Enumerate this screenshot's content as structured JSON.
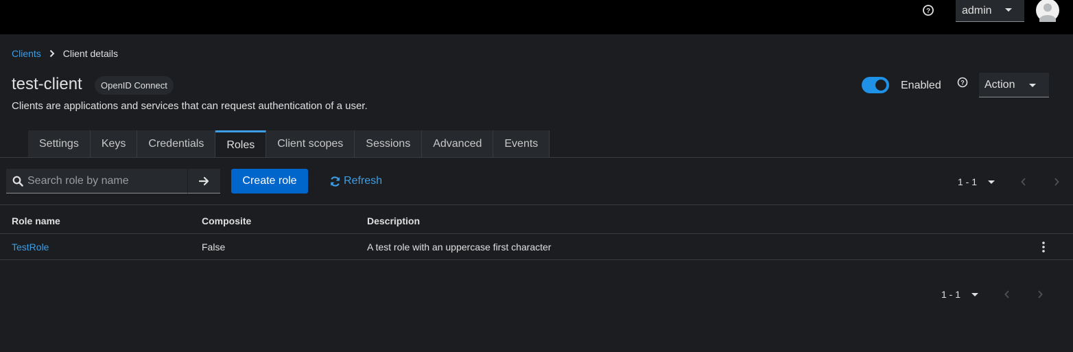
{
  "header": {
    "user": "admin"
  },
  "breadcrumb": {
    "parent": "Clients",
    "current": "Client details"
  },
  "client": {
    "name": "test-client",
    "protocol": "OpenID Connect",
    "description": "Clients are applications and services that can request authentication of a user.",
    "enabled_label": "Enabled",
    "enabled": true,
    "action_label": "Action"
  },
  "tabs": [
    {
      "label": "Settings",
      "active": false
    },
    {
      "label": "Keys",
      "active": false
    },
    {
      "label": "Credentials",
      "active": false
    },
    {
      "label": "Roles",
      "active": true
    },
    {
      "label": "Client scopes",
      "active": false
    },
    {
      "label": "Sessions",
      "active": false
    },
    {
      "label": "Advanced",
      "active": false
    },
    {
      "label": "Events",
      "active": false
    }
  ],
  "toolbar": {
    "search_placeholder": "Search role by name",
    "create_label": "Create role",
    "refresh_label": "Refresh",
    "pagination_top": "1 - 1",
    "pagination_bottom": "1 - 1"
  },
  "table": {
    "columns": [
      "Role name",
      "Composite",
      "Description"
    ],
    "rows": [
      [
        "TestRole",
        "False",
        "A test role with an uppercase first character"
      ]
    ]
  },
  "colors": {
    "accent": "#0066cc",
    "link": "#3d9ee6",
    "toggle_on": "#1f91e6",
    "background": "#1b1d21"
  },
  "icons": [
    "help-icon",
    "caret-down-icon",
    "user-avatar-icon",
    "chevron-right-icon",
    "search-icon",
    "arrow-right-icon",
    "refresh-icon",
    "angle-left-icon",
    "angle-right-icon",
    "kebab-icon"
  ]
}
